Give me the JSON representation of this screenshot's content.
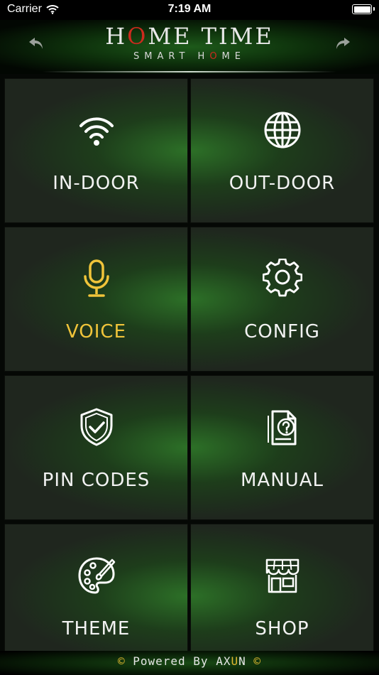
{
  "status_bar": {
    "carrier": "Carrier",
    "time": "7:19 AM"
  },
  "header": {
    "title_part1": "H",
    "title_accent": "O",
    "title_part2": "ME TIME",
    "subtitle_part1": "SMART H",
    "subtitle_accent": "O",
    "subtitle_part2": "ME",
    "accent_color": "#cc2a1e",
    "back_icon": "back-arrow-icon",
    "forward_icon": "forward-arrow-icon"
  },
  "tiles": [
    {
      "label": "IN-DOOR",
      "icon": "wifi-icon",
      "active": false
    },
    {
      "label": "OUT-DOOR",
      "icon": "globe-icon",
      "active": false
    },
    {
      "label": "VOICE",
      "icon": "microphone-icon",
      "active": true
    },
    {
      "label": "CONFIG",
      "icon": "gear-icon",
      "active": false
    },
    {
      "label": "PIN CODES",
      "icon": "shield-check-icon",
      "active": false
    },
    {
      "label": "MANUAL",
      "icon": "document-question-icon",
      "active": false
    },
    {
      "label": "THEME",
      "icon": "palette-icon",
      "active": false
    },
    {
      "label": "SHOP",
      "icon": "storefront-icon",
      "active": false
    }
  ],
  "footer": {
    "copyright_symbol": "©",
    "prefix": "Powered By AX",
    "accent": "U",
    "suffix": "N",
    "accent_color": "#e0b830"
  },
  "colors": {
    "active_label": "#f0c43a",
    "label": "#f2f2f2",
    "tile_green": "#2e7828"
  }
}
